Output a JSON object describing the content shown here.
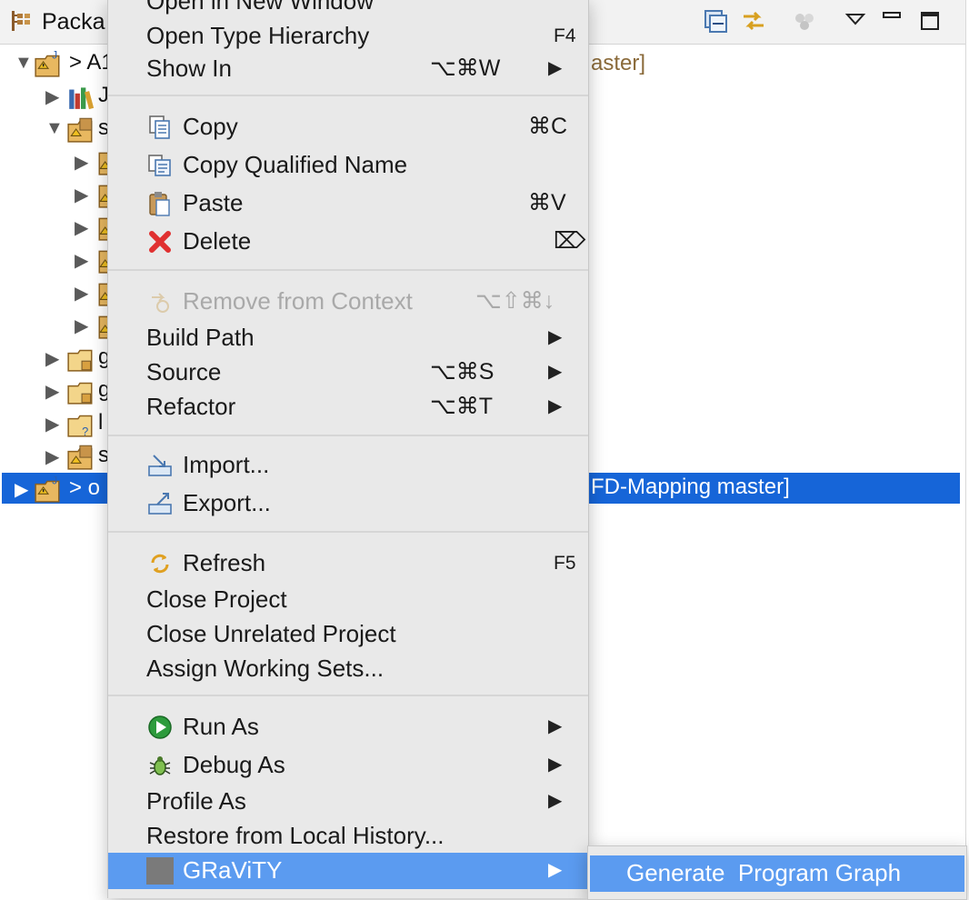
{
  "view": {
    "title": "Packa",
    "rows": [
      {
        "label": "> A1",
        "decoration": "aster]"
      },
      {
        "label": "J"
      },
      {
        "label": "s"
      },
      {
        "label": ""
      },
      {
        "label": ""
      },
      {
        "label": ""
      },
      {
        "label": ""
      },
      {
        "label": ""
      },
      {
        "label": ""
      },
      {
        "label": "g"
      },
      {
        "label": "g"
      },
      {
        "label": "l"
      },
      {
        "label": "s"
      },
      {
        "label": "> o",
        "decoration": "FD-Mapping master]"
      }
    ]
  },
  "menu": {
    "top_item": {
      "label": "Open in New Window"
    },
    "groups": [
      [
        {
          "label": "Open Type Hierarchy",
          "shortcut": "F4"
        },
        {
          "label": "Show In",
          "shortcut": "⌥⌘W",
          "submenu": "▶"
        }
      ],
      [
        {
          "label": "Copy",
          "shortcut": "⌘C",
          "icon": "copy-icon"
        },
        {
          "label": "Copy Qualified Name",
          "icon": "copy-qualified-name-icon"
        },
        {
          "label": "Paste",
          "shortcut": "⌘V",
          "icon": "paste-icon"
        },
        {
          "label": "Delete",
          "shortcut": "⌦",
          "icon": "delete-icon"
        }
      ],
      [
        {
          "label": "Remove from Context",
          "shortcut": "⌥⇧⌘↓",
          "icon": "remove-from-context-icon",
          "disabled": true
        },
        {
          "label": "Build Path",
          "submenu": "▶"
        },
        {
          "label": "Source",
          "shortcut": "⌥⌘S",
          "submenu": "▶"
        },
        {
          "label": "Refactor",
          "shortcut": "⌥⌘T",
          "submenu": "▶"
        }
      ],
      [
        {
          "label": "Import...",
          "icon": "import-icon"
        },
        {
          "label": "Export...",
          "icon": "export-icon"
        }
      ],
      [
        {
          "label": "Refresh",
          "shortcut": "F5",
          "icon": "refresh-icon"
        },
        {
          "label": "Close Project"
        },
        {
          "label": "Close Unrelated Project"
        },
        {
          "label": "Assign Working Sets..."
        }
      ],
      [
        {
          "label": "Run As",
          "submenu": "▶",
          "icon": "run-icon"
        },
        {
          "label": "Debug As",
          "submenu": "▶",
          "icon": "debug-bug-icon"
        },
        {
          "label": "Profile As",
          "submenu": "▶"
        },
        {
          "label": "Restore from Local History..."
        },
        {
          "label": "GRaViTY",
          "submenu": "▶",
          "icon": "gravity-square-icon",
          "highlighted": true
        }
      ]
    ]
  },
  "submenu": {
    "item": "Generate  Program Graph"
  },
  "colors": {
    "menu_bg": "#e9e9e9",
    "highlight": "#5b9bf0",
    "selection": "#1665d8",
    "decoration": "#8a6a3a"
  }
}
